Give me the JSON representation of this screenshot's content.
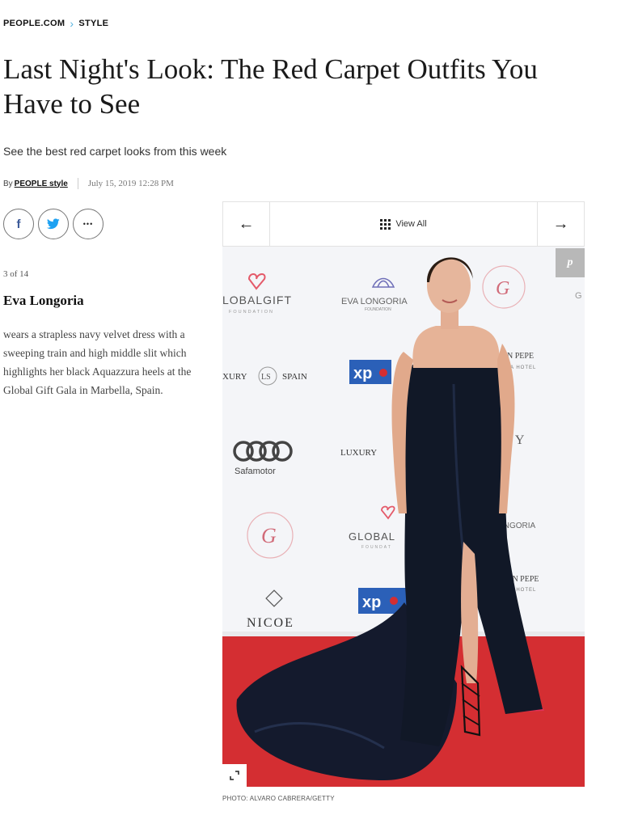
{
  "breadcrumb": {
    "site": "PEOPLE.COM",
    "separator": "›",
    "section": "STYLE"
  },
  "article": {
    "title": "Last Night's Look: The Red Carpet Outfits You Have to See",
    "subtitle": "See the best red carpet looks from this week",
    "by": "By",
    "author": "PEOPLE style",
    "date": "July 15, 2019 12:28 PM"
  },
  "share": {
    "facebook_icon": "f",
    "twitter_icon": "twitter-bird",
    "more_icon": "•••",
    "colors": {
      "facebook": "#3b5998",
      "twitter": "#1da1f2",
      "border": "#777777"
    }
  },
  "slide": {
    "counter": "3 of 14",
    "name": "Eva Longoria",
    "description": "wears a strapless navy velvet dress with a sweeping train and high middle slit which highlights her black Aquazzura heels at the Global Gift Gala in Marbella, Spain."
  },
  "gallery_nav": {
    "prev_icon": "←",
    "view_all_label": "View All",
    "next_icon": "→"
  },
  "photo": {
    "pinterest_icon": "p",
    "backdrop_logos": {
      "global_gift": "LOBALGIFT",
      "global_gift_sub": "FOUNDATION",
      "eva_foundation": "EVA LONGORIA",
      "eva_foundation_sub": "FOUNDATION",
      "luxury_spain": "XURY",
      "luxury_spain_badge": "LS",
      "luxury_spain_right": "SPAIN",
      "xpos_1": "xp",
      "xpos_2": "xp",
      "audi_sub": "Safamotor",
      "luxury": "LUXURY",
      "global_2": "GLOBAL",
      "global_2_sub": "FOUNDAT",
      "nicole": "NICOE",
      "don_pepe_1": "N PEPE",
      "don_pepe_1_sub": "A HOTEL",
      "don_pepe_2": "DON PEPE",
      "don_pepe_2_sub": "MELIA HOTEL",
      "ongoria": "ONGORIA",
      "py": "PY",
      "g_edge": "G"
    },
    "colors": {
      "carpet": "#d42e32",
      "dress": "#111827",
      "xpos": "#2b60b8",
      "heart": "#e45a6a"
    }
  },
  "credit": "PHOTO: ALVARO CABRERA/GETTY"
}
